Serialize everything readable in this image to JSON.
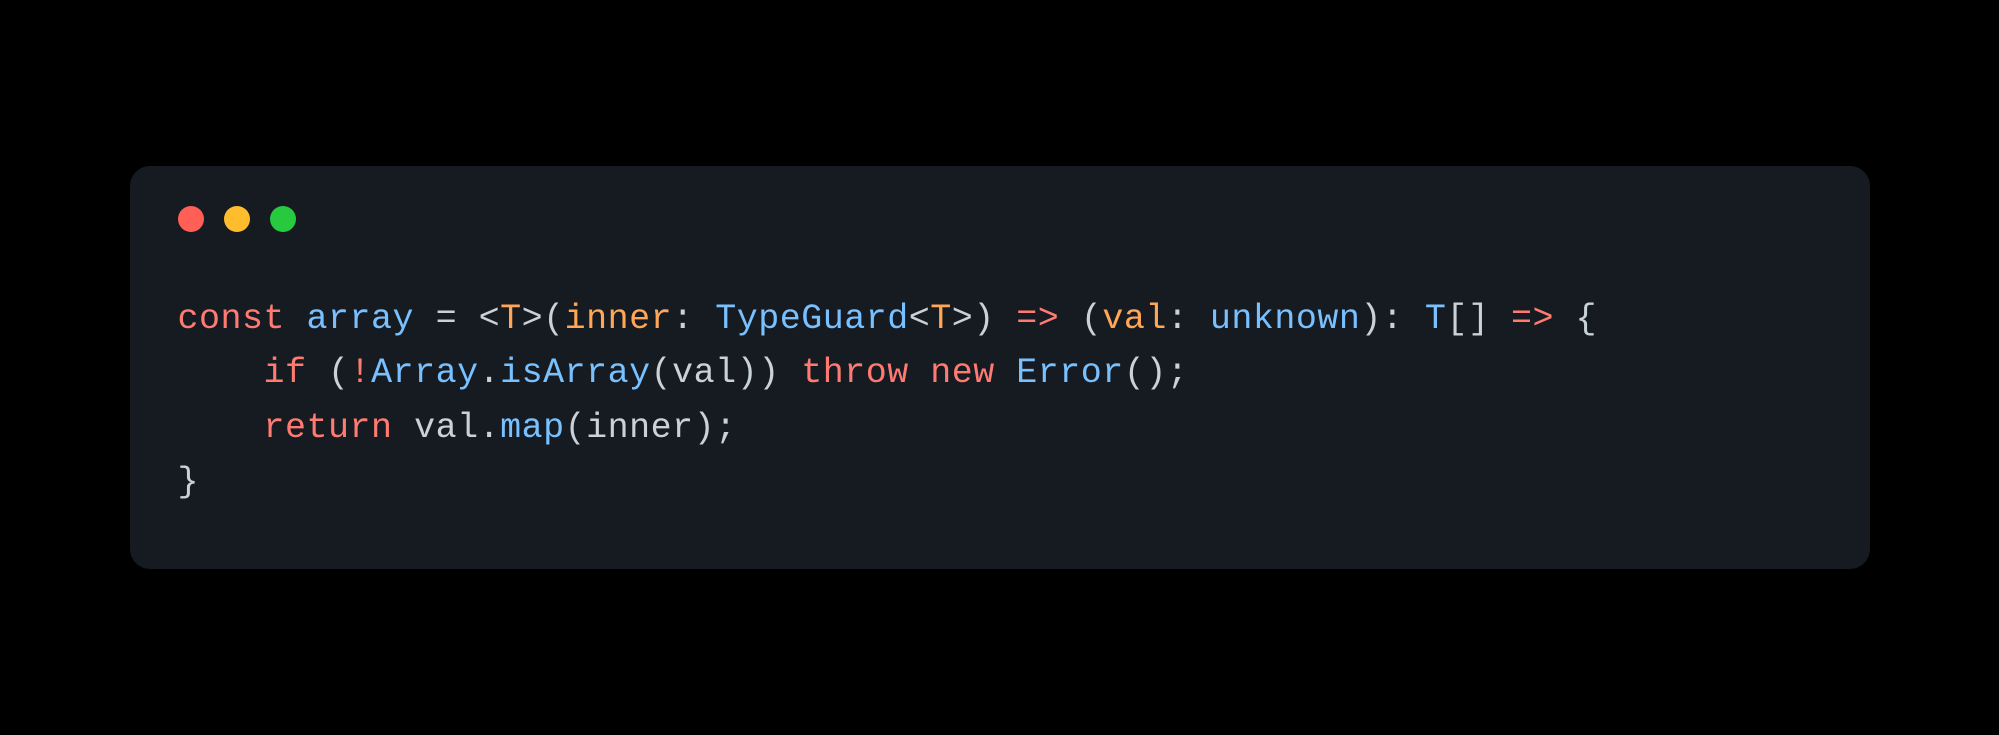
{
  "window": {
    "traffic_light_red": "close",
    "traffic_light_yellow": "minimize",
    "traffic_light_green": "maximize"
  },
  "code": {
    "indent": "    ",
    "line1": {
      "kw_const": "const",
      "fn_name": "array",
      "eq": " = ",
      "lt1": "<",
      "generic_T1": "T",
      "gt1": ">",
      "open_paren1": "(",
      "param_inner": "inner",
      "colon1": ": ",
      "type_TypeGuard": "TypeGuard",
      "lt2": "<",
      "generic_T2": "T",
      "gt2": ">",
      "close_paren1": ")",
      "arrow1": " => ",
      "open_paren2": "(",
      "param_val": "val",
      "colon2": ": ",
      "type_unknown": "unknown",
      "close_paren2": ")",
      "colon3": ": ",
      "ret_T": "T",
      "ret_brackets": "[]",
      "arrow2": " => ",
      "open_brace": "{"
    },
    "line2": {
      "kw_if": "if",
      "open_paren": " (",
      "bang": "!",
      "class_Array": "Array",
      "dot": ".",
      "method_isArray": "isArray",
      "open_paren2": "(",
      "arg_val": "val",
      "close_paren2": ")",
      "close_paren": ") ",
      "kw_throw": "throw",
      "space1": " ",
      "kw_new": "new",
      "space2": " ",
      "class_Error": "Error",
      "call_parens": "()",
      "semi": ";"
    },
    "line3": {
      "kw_return": "return",
      "space": " ",
      "ident_val": "val",
      "dot": ".",
      "method_map": "map",
      "open_paren": "(",
      "arg_inner": "inner",
      "close_paren": ")",
      "semi": ";"
    },
    "line4": {
      "close_brace": "}"
    }
  }
}
